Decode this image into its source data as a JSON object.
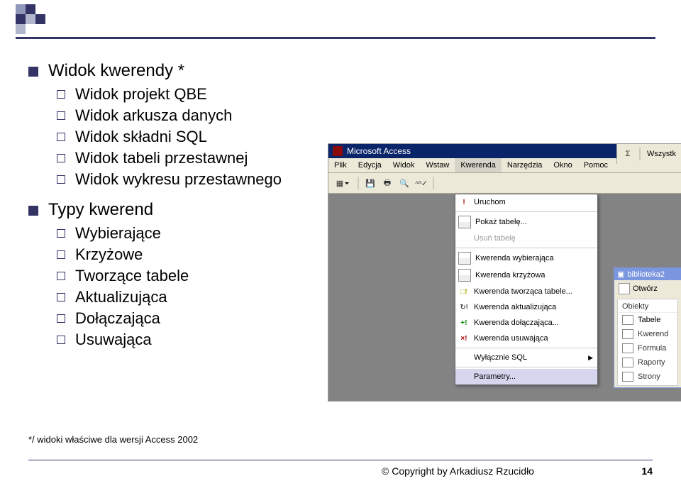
{
  "bullets": {
    "b1": "Widok kwerendy *",
    "b1_items": [
      "Widok projekt QBE",
      "Widok arkusza danych",
      "Widok składni SQL",
      "Widok tabeli przestawnej",
      "Widok wykresu przestawnego"
    ],
    "b2": "Typy kwerend",
    "b2_items": [
      "Wybierające",
      "Krzyżowe",
      "Tworzące tabele",
      "Aktualizująca",
      "Dołączająca",
      "Usuwająca"
    ]
  },
  "screenshot": {
    "title": "Microsoft Access",
    "menu": [
      "Plik",
      "Edycja",
      "Widok",
      "Wstaw",
      "Kwerenda",
      "Narzędzia",
      "Okno",
      "Pomoc"
    ],
    "toolbar_right_sigma": "Σ",
    "toolbar_right_text": "Wszystk",
    "dropdown": [
      {
        "type": "item",
        "label": "Uruchom",
        "iconClass": "red",
        "icon": "!"
      },
      {
        "type": "sep"
      },
      {
        "type": "item",
        "label": "Pokaż tabelę...",
        "iconClass": "grid",
        "icon": ""
      },
      {
        "type": "item",
        "label": "Usuń tabelę",
        "disabled": true
      },
      {
        "type": "sep"
      },
      {
        "type": "item",
        "label": "Kwerenda wybierająca",
        "iconClass": "grid",
        "icon": ""
      },
      {
        "type": "item",
        "label": "Kwerenda krzyżowa",
        "iconClass": "grid",
        "icon": ""
      },
      {
        "type": "item",
        "label": "Kwerenda tworząca tabele...",
        "iconClass": "yel",
        "icon": "□!"
      },
      {
        "type": "item",
        "label": "Kwerenda aktualizująca",
        "iconClass": "",
        "icon": "↻!"
      },
      {
        "type": "item",
        "label": "Kwerenda dołączająca...",
        "iconClass": "green",
        "icon": "+!"
      },
      {
        "type": "item",
        "label": "Kwerenda usuwająca",
        "iconClass": "red",
        "icon": "×!"
      },
      {
        "type": "sep"
      },
      {
        "type": "item",
        "label": "Wyłącznie SQL",
        "arrow": true
      },
      {
        "type": "sep"
      },
      {
        "type": "item",
        "label": "Parametry...",
        "selected": true
      }
    ],
    "right_panel": {
      "title": "biblioteka2",
      "open": "Otwórz",
      "group_header": "Obiekty",
      "items": [
        "Tabele",
        "Kwerend",
        "Formula",
        "Raporty",
        "Strony"
      ]
    }
  },
  "footnote": "*/ widoki właściwe dla wersji Access 2002",
  "copyright": "©  Copyright by Arkadiusz Rzucidło",
  "page": "14"
}
